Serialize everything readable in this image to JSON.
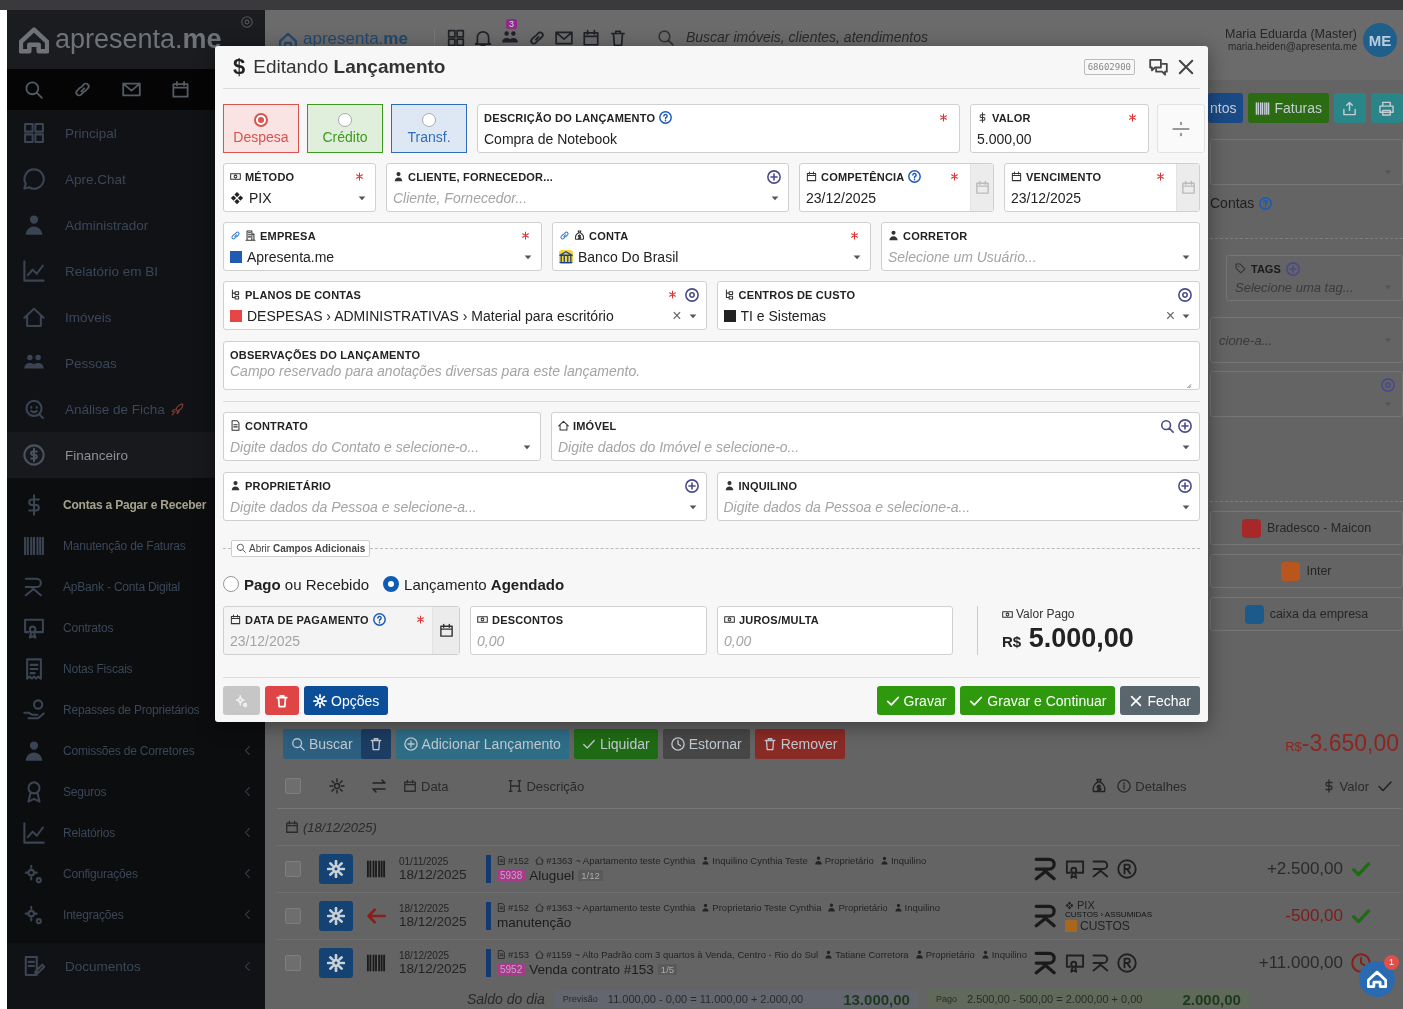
{
  "sidebar": {
    "logo": "apresenta.**me**",
    "menu": [
      {
        "label": "Principal"
      },
      {
        "label": "Apre.Chat"
      },
      {
        "label": "Administrador"
      },
      {
        "label": "Relatório em BI"
      },
      {
        "label": "Imóveis"
      },
      {
        "label": "Pessoas"
      },
      {
        "label": "Análise de Ficha"
      },
      {
        "label": "Financeiro",
        "expanded": true,
        "children": [
          {
            "label": "Contas a Pagar e Receber",
            "selected": true
          },
          {
            "label": "Manutenção de Faturas",
            "selected": false
          },
          {
            "label": "ApBank - Conta Digital",
            "selected": false
          },
          {
            "label": "Contratos",
            "selected": false
          },
          {
            "label": "Notas Fiscais",
            "selected": false
          },
          {
            "label": "Repasses de Proprietários",
            "selected": false
          },
          {
            "label": "Comissões de Corretores",
            "selected": false,
            "submenu": true
          },
          {
            "label": "Seguros",
            "selected": false,
            "submenu": true
          },
          {
            "label": "Relatórios",
            "selected": false,
            "submenu": true
          },
          {
            "label": "Configurações",
            "selected": false,
            "submenu": true
          },
          {
            "label": "Integrações",
            "selected": false,
            "submenu": true
          }
        ]
      },
      {
        "label": "Documentos",
        "submenu": true
      }
    ]
  },
  "header": {
    "logo": "apresenta.**me**",
    "notification_count": "3",
    "search_placeholder": "Buscar imóveis, clientes, atendimentos",
    "user": {
      "name": "Maria Eduarda (Master)",
      "email": "maria.heiden@apresenta.me",
      "initials": "ME"
    }
  },
  "right_panel": {
    "buttons": [
      {
        "kind": "primary",
        "label": "ntos"
      },
      {
        "kind": "invoices",
        "label": "Faturas"
      },
      {
        "kind": "export"
      },
      {
        "kind": "print"
      }
    ],
    "contas_label": "Contas",
    "tags": {
      "label": "TAGS",
      "placeholder": "Selecione uma tag..."
    },
    "partial_placeholder": "cione-a...",
    "accounts": [
      {
        "name": "Bradesco - Maicon",
        "color": "#a8282a"
      },
      {
        "name": "Inter",
        "color": "#b8561e"
      },
      {
        "name": "caixa da empresa",
        "color": "#1d5a8c"
      }
    ]
  },
  "toolbar": {
    "actions": [
      {
        "kind": "search",
        "label": "Buscar"
      },
      {
        "kind": "trash"
      },
      {
        "kind": "add",
        "label": "Adicionar Lançamento"
      },
      {
        "kind": "settle",
        "label": "Liquidar"
      },
      {
        "kind": "reverse",
        "label": "Estornar"
      },
      {
        "kind": "remove",
        "label": "Remover"
      }
    ],
    "total": {
      "currency": "R$",
      "value": "-3.650,00"
    }
  },
  "table": {
    "all_selected": false,
    "columns": [
      {
        "label": "Data"
      },
      {
        "label": "Descrição"
      },
      {
        "label": "Detalhes"
      },
      {
        "label": "Valor"
      }
    ],
    "group_date": "(18/12/2025)",
    "rows": [
      {
        "selected": false,
        "kind": "barcode",
        "date_small": "01/11/2025",
        "date": "18/12/2025",
        "meta": [
          {
            "kind": "contract",
            "text": "#152"
          },
          {
            "kind": "property",
            "text": "#1363 ~ Apartamento teste Cynthia"
          },
          {
            "kind": "person",
            "text": "Inquilino Cynthia Teste"
          },
          {
            "kind": "owner",
            "text": "Proprietário"
          },
          {
            "kind": "person",
            "text": "Inquilino"
          }
        ],
        "code": {
          "text": "5938",
          "color": "#a83a8c"
        },
        "title": "Aluguel",
        "installment": "1/12",
        "details": {
          "kind": "icons"
        },
        "value": "+2.500,00",
        "negative": false,
        "paid": true
      },
      {
        "selected": false,
        "kind": "arrow",
        "date_small": "18/12/2025",
        "date": "18/12/2025",
        "meta": [
          {
            "kind": "contract",
            "text": "#152"
          },
          {
            "kind": "property",
            "text": "#1363 ~ Apartamento teste Cynthia"
          },
          {
            "kind": "person",
            "text": "Proprietario Teste Cynthia"
          },
          {
            "kind": "owner",
            "text": "Proprietário"
          },
          {
            "kind": "person",
            "text": "Inquilino"
          }
        ],
        "title": "manutenção",
        "details": {
          "kind": "payment",
          "method": "PIX",
          "path": "CUSTOS › ASSUMIDAS",
          "category": "CUSTOS",
          "color": "#a8671c"
        },
        "value": "-500,00",
        "negative": true,
        "paid": true
      },
      {
        "selected": false,
        "kind": "barcode",
        "date_small": "18/12/2025",
        "date": "18/12/2025",
        "meta": [
          {
            "kind": "contract",
            "text": "#153"
          },
          {
            "kind": "property",
            "text": "#1159 ~ Alto Padrão com 3 quartos à Venda, Centro - Rio do Sul"
          },
          {
            "kind": "person",
            "text": "Tatiane Corretora"
          },
          {
            "kind": "owner",
            "text": "Proprietário"
          },
          {
            "kind": "person",
            "text": "Inquilino"
          }
        ],
        "code": {
          "text": "5952",
          "color": "#a83a8c"
        },
        "title": "Venda contrato #153",
        "installment": "1/5",
        "details": {
          "kind": "icons"
        },
        "value": "+11.000,00",
        "negative": false,
        "paid": false
      }
    ],
    "summary": {
      "label": "Saldo do dia",
      "forecast": {
        "label": "Previsão",
        "formula": "11.000,00 - 0,00 = 11.000,00 + 2.000,00",
        "total": "13.000,00"
      },
      "paid": {
        "label": "Pago",
        "formula": "2.500,00 - 500,00 = 2.000,00 + 0,00",
        "total": "2.000,00"
      }
    }
  },
  "help_fab": {
    "badge": "1"
  },
  "modal": {
    "title_glyph": "$",
    "title": "Editando **Lançamento**",
    "record_id": "68602900",
    "types": [
      {
        "label": "Despesa",
        "selected": true,
        "color": "#d9534f"
      },
      {
        "label": "Crédito",
        "selected": false,
        "color": "#3d9a1e"
      },
      {
        "label": "Transf.",
        "selected": false,
        "color": "#2f6db8"
      }
    ],
    "rows": [
      [
        {
          "kind": "text",
          "label": "DESCRIÇÃO DO LANÇAMENTO",
          "help": true,
          "required": true,
          "value": "Compra de Notebook"
        },
        {
          "kind": "text",
          "label": "VALOR",
          "help": false,
          "required": true,
          "value": "5.000,00"
        }
      ],
      [
        {
          "kind": "select",
          "label": "MÉTODO",
          "help": false,
          "required": true,
          "value": "PIX"
        },
        {
          "kind": "select",
          "label": "CLIENTE, FORNECEDOR...",
          "help": false,
          "required": false,
          "placeholder": "Cliente, Fornecedor..."
        },
        {
          "kind": "date",
          "label": "COMPETÊNCIA",
          "help": true,
          "required": true,
          "disabled": false,
          "value": "23/12/2025"
        },
        {
          "kind": "date",
          "label": "VENCIMENTO",
          "help": false,
          "required": true,
          "disabled": false,
          "value": "23/12/2025"
        }
      ],
      [
        {
          "kind": "select",
          "label": "EMPRESA",
          "help": false,
          "required": true,
          "value": "Apresenta.me",
          "color": "#1f5bb5"
        },
        {
          "kind": "select",
          "label": "CONTA",
          "help": false,
          "required": true,
          "value": "Banco Do Brasil"
        },
        {
          "kind": "select",
          "label": "CORRETOR",
          "help": false,
          "required": false,
          "placeholder": "Selecione um Usuário..."
        }
      ],
      [
        {
          "kind": "select",
          "label": "PLANOS DE CONTAS",
          "help": false,
          "required": true,
          "value": "DESPESAS › ADMINISTRATIVAS › Material para escritório",
          "color": "#e84545",
          "clear_glyph": "×"
        },
        {
          "kind": "select",
          "label": "CENTROS DE CUSTO",
          "help": false,
          "required": false,
          "value": "TI e Sistemas",
          "color": "#222222",
          "clear_glyph": "×"
        }
      ],
      [
        {
          "kind": "textarea",
          "label": "OBSERVAÇÕES DO LANÇAMENTO",
          "help": false,
          "required": false,
          "placeholder": "Campo reservado para anotações diversas para este lançamento."
        }
      ],
      [
        {
          "kind": "select",
          "label": "CONTRATO",
          "help": false,
          "required": false,
          "placeholder": "Digite dados do Contato e selecione-o..."
        },
        {
          "kind": "select",
          "label": "IMÓVEL",
          "help": false,
          "required": false,
          "placeholder": "Digite dados do Imóvel e selecione-o..."
        }
      ],
      [
        {
          "kind": "select",
          "label": "PROPRIETÁRIO",
          "help": false,
          "required": false,
          "placeholder": "Digite dados da Pessoa e selecione-a..."
        },
        {
          "kind": "select",
          "label": "INQUILINO",
          "help": false,
          "required": false,
          "placeholder": "Digite dados da Pessoa e selecione-a..."
        }
      ]
    ],
    "extra_fields_button": "Abrir **Campos Adicionais**",
    "status": [
      {
        "label": "**Pago** ou Recebido",
        "selected": false
      },
      {
        "label": "Lançamento **Agendado**",
        "selected": true
      }
    ],
    "payment": [
      {
        "kind": "date",
        "label": "DATA DE PAGAMENTO",
        "help": true,
        "required": true,
        "disabled": true,
        "value": "23/12/2025"
      },
      {
        "kind": "text",
        "label": "DESCONTOS",
        "help": false,
        "required": false,
        "placeholder": "0,00"
      },
      {
        "kind": "text",
        "label": "JUROS/MULTA",
        "help": false,
        "required": false,
        "placeholder": "0,00"
      }
    ],
    "paid_value": {
      "label": "Valor Pago",
      "currency": "R$",
      "value": "5.000,00"
    },
    "left_buttons": [
      {
        "kind": "gears",
        "disabled": true
      },
      {
        "kind": "delete",
        "disabled": false
      },
      {
        "kind": "options",
        "label": "Opções",
        "disabled": false
      }
    ],
    "right_buttons": [
      {
        "kind": "save",
        "label": "Gravar"
      },
      {
        "kind": "save",
        "label": "Gravar e Continuar"
      },
      {
        "kind": "close",
        "label": "Fechar"
      }
    ]
  }
}
